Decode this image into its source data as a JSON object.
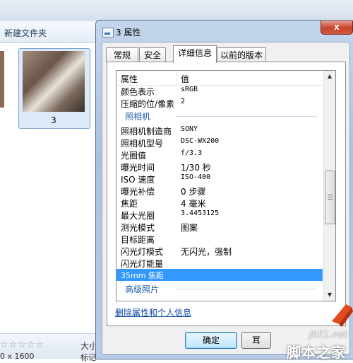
{
  "explorer": {
    "folder_title": "新建文件夹",
    "thumbnail_label": "3",
    "stars": "☆☆☆☆☆",
    "size_label": "大小",
    "resolution": "0 x 1600",
    "tags_label": "标记"
  },
  "dialog": {
    "title": "3 属性",
    "close_glyph": "x",
    "tabs": [
      {
        "label": "常规",
        "active": false
      },
      {
        "label": "安全",
        "active": false
      },
      {
        "label": "详细信息",
        "active": true
      },
      {
        "label": "以前的版本",
        "active": false
      }
    ],
    "columns": {
      "property": "属性",
      "value": "值"
    },
    "rows_before": [
      {
        "k": "颜色表示",
        "v": "sRGB"
      },
      {
        "k": "压缩的位/像素",
        "v": "2"
      }
    ],
    "group_camera": "照相机",
    "camera_rows": [
      {
        "k": "照相机制造商",
        "v": "SONY"
      },
      {
        "k": "照相机型号",
        "v": "DSC-WX200"
      },
      {
        "k": "光圈值",
        "v": "f/3.3"
      },
      {
        "k": "曝光时间",
        "v": "1/30 秒"
      },
      {
        "k": "ISO 速度",
        "v": "ISO-400"
      },
      {
        "k": "曝光补偿",
        "v": "0 步骤"
      },
      {
        "k": "焦距",
        "v": "4 毫米"
      },
      {
        "k": "最大光圈",
        "v": "3.4453125"
      },
      {
        "k": "测光模式",
        "v": "图案"
      },
      {
        "k": "目标距离",
        "v": ""
      },
      {
        "k": "闪光灯模式",
        "v": "无闪光，强制"
      },
      {
        "k": "闪光灯能量",
        "v": ""
      },
      {
        "k": "35mm 焦距",
        "v": "",
        "selected": true
      }
    ],
    "group_advanced": "高级照片",
    "remove_link": "删除属性和个人信息",
    "ok_button": "确定",
    "cancel_button_partial": "耳"
  },
  "watermark": {
    "site": "jb51.net",
    "text": "脚本之家"
  },
  "colors": {
    "selection": "#3399ff",
    "group_text": "#1e5aa8",
    "link": "#0a47a6"
  }
}
